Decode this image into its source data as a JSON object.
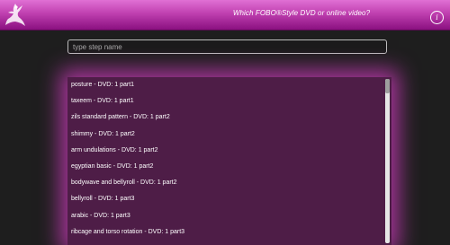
{
  "header": {
    "title": "Which FOBO®Style DVD or online video?",
    "info_glyph": "i",
    "logo_icon": "dancer-logo-icon",
    "colors": {
      "top": "#e070d4",
      "bottom": "#8a1080"
    }
  },
  "search": {
    "placeholder": "type step name",
    "value": ""
  },
  "results": {
    "items": [
      "posture - DVD: 1 part1",
      "taxeem - DVD: 1 part1",
      "zils standard pattern - DVD: 1 part2",
      "shimmy - DVD: 1 part2",
      "arm undulations - DVD: 1 part2",
      "egyptian basic - DVD: 1 part2",
      "bodywave and bellyroll - DVD: 1 part2",
      "bellyroll - DVD: 1 part3",
      "arabic - DVD: 1 part3",
      "ribcage and torso rotation - DVD: 1 part3"
    ],
    "panel_color": "#4e1d47",
    "glow_color": "#d63cc4"
  }
}
